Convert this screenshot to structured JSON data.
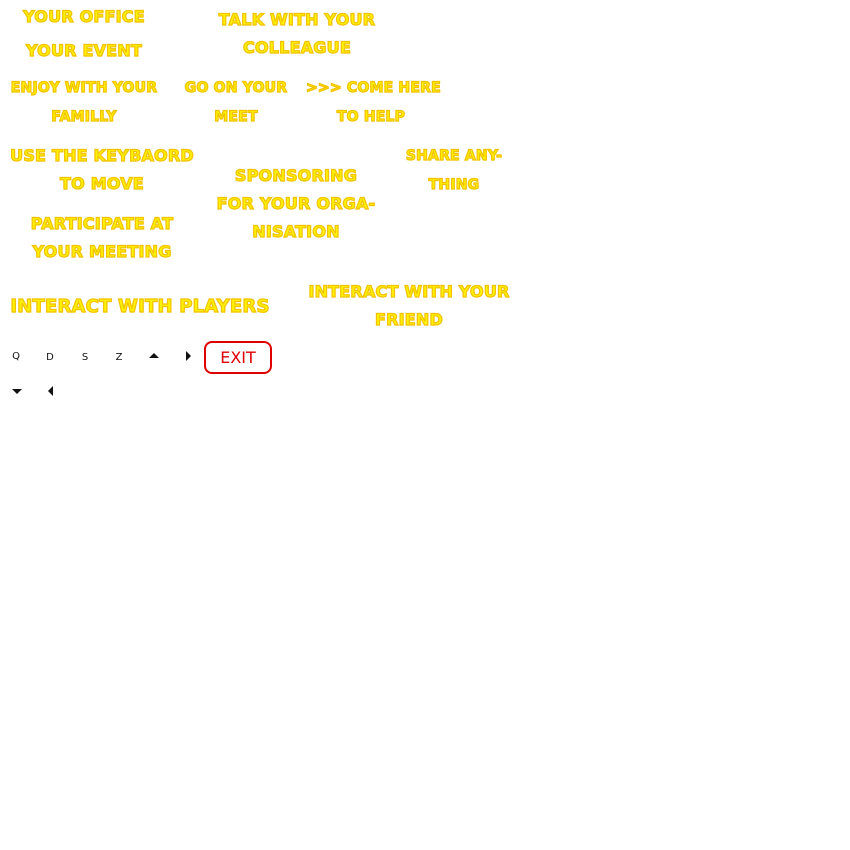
{
  "slogans": {
    "your_office": "YOUR OFFICE",
    "your_event": "YOUR EVENT",
    "talk_colleague": [
      "TALK WITH YOUR",
      "COLLEAGUE"
    ],
    "enjoy_family": [
      "ENJOY WITH YOUR",
      "FAMILLY"
    ],
    "go_meet": [
      "GO ON YOUR",
      "MEET"
    ],
    "come_help": [
      ">>> COME HERE",
      "TO HELP"
    ],
    "keyboard_move": [
      "USE THE KEYBAORD",
      "TO MOVE"
    ],
    "sponsoring": [
      "SPONSORING",
      "FOR YOUR ORGA-",
      "NISATION"
    ],
    "share": [
      "SHARE ANY-",
      "THING"
    ],
    "participate": [
      "PARTICIPATE AT",
      "YOUR MEETING"
    ],
    "interact_players": "INTERACT WITH PLAYERS",
    "interact_friend": [
      "INTERACT WITH YOUR",
      "FRIEND"
    ]
  },
  "controls": {
    "keys": [
      "Q",
      "D",
      "S",
      "Z"
    ],
    "arrow_icons": [
      "arrow-up-icon",
      "arrow-right-icon",
      "arrow-down-icon",
      "arrow-left-icon"
    ],
    "exit_label": "EXIT"
  },
  "colors": {
    "slogan_fill": "#fff200",
    "slogan_outline": "#f2c200",
    "exit_red": "#e00000",
    "key_text": "#111111"
  }
}
